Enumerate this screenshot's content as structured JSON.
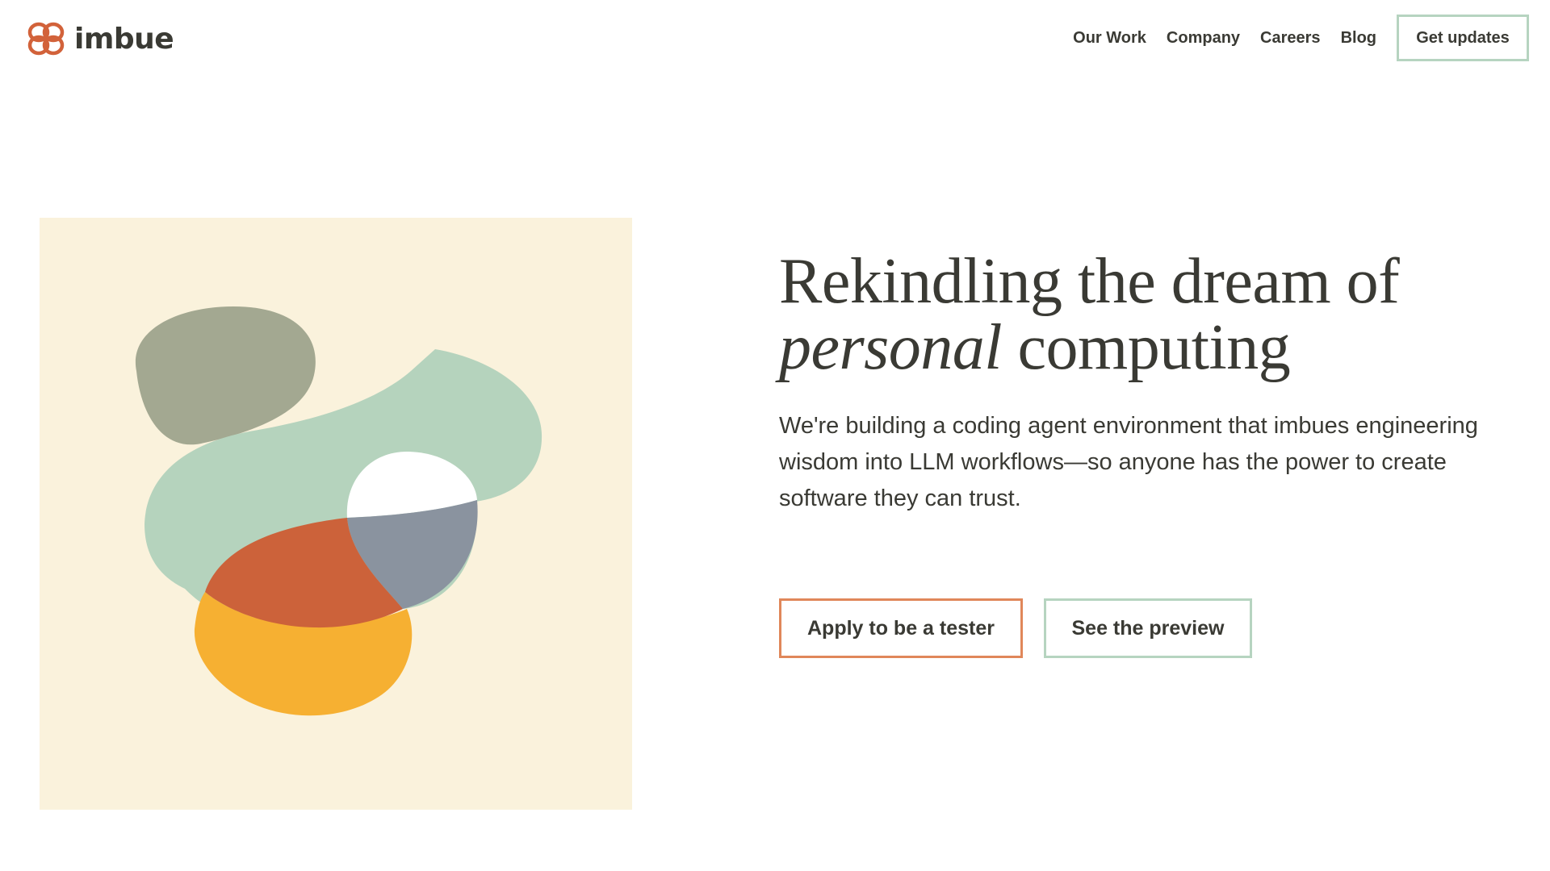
{
  "brand": {
    "name": "imbue",
    "logo_icon": "imbue-knot-logo-icon",
    "logo_color": "#d2623a"
  },
  "nav": {
    "links": [
      "Our Work",
      "Company",
      "Careers",
      "Blog"
    ],
    "cta": "Get updates"
  },
  "hero": {
    "title_line1": "Rekindling the dream of",
    "title_italic": "personal",
    "title_rest": " computing",
    "subtitle": "We're building a coding agent environment that imbues engineering wisdom into LLM workflows—so anyone has the power to create software they can trust.",
    "primary_cta": "Apply to be a tester",
    "secondary_cta": "See the preview"
  },
  "colors": {
    "text": "#3a3a34",
    "art_background": "#faf2dc",
    "sage_blob": "#a3a891",
    "mint_blob": "#b5d3bd",
    "rust_blob": "#cc623a",
    "slate_blob": "#8a939f",
    "amber_blob": "#f6b032",
    "accent_border_primary": "#e0875a",
    "accent_border_secondary": "#b6d4c0"
  }
}
